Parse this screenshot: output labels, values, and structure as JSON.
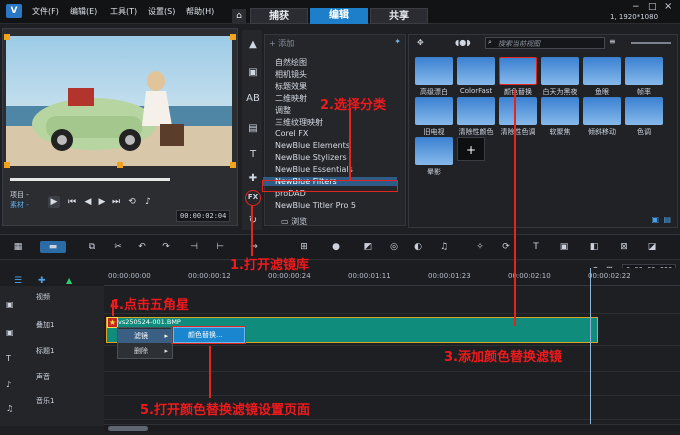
{
  "title_bar": {
    "menu": [
      "文件(F)",
      "编辑(E)",
      "工具(T)",
      "设置(S)",
      "帮助(H)"
    ],
    "tabs": [
      "捕获",
      "编辑",
      "共享"
    ],
    "resolution": "1, 1920*1080"
  },
  "preview": {
    "labels": [
      "项目 -",
      "素材 -"
    ],
    "timecode": "00:00:02:04"
  },
  "library": {
    "add_label": "添加",
    "browse_label": "浏览",
    "search_placeholder": "搜索当前视图",
    "fx_label": "FX",
    "filter_categories": [
      "自然绘图",
      "相机镜头",
      "标题效果",
      "二维映射",
      "调整",
      "三维纹理映射",
      "Corel FX",
      "NewBlue Elements",
      "NewBlue Stylizers",
      "NewBlue Essentials",
      "NewBlue Filters",
      "proDAD",
      "NewBlue Titler Pro 5"
    ],
    "selected_category": "NewBlue Filters",
    "filters": [
      "高级漂白",
      "ColorFast",
      "颜色替换",
      "白天为黑夜",
      "鱼眼",
      "帧率",
      "旧电视",
      "清除性颜色",
      "清除性色调",
      "软聚焦",
      "倾斜移动",
      "色调",
      "晕影"
    ],
    "add_tile": "+"
  },
  "timeline": {
    "timecode": "0:00:03:000",
    "ruler_marks": [
      "00:00:00:00",
      "00:00:00:12",
      "00:00:00:24",
      "00:00:01:11",
      "00:00:01:23",
      "00:00:02:10",
      "00:00:02:22"
    ],
    "tracks": [
      "视频",
      "叠加1",
      "标题1",
      "声音",
      "音乐1"
    ],
    "clip_name": "vs250524-001.BMP",
    "context_menu": [
      "滤镜",
      "删除"
    ],
    "submenu_item": "颜色替换..."
  },
  "annotations": {
    "step1": "1.打开滤镜库",
    "step2": "2.选择分类",
    "step3": "3.添加颜色替换滤镜",
    "step4": "4.点击五角星",
    "step5": "5.打开颜色替换滤镜设置页面"
  }
}
